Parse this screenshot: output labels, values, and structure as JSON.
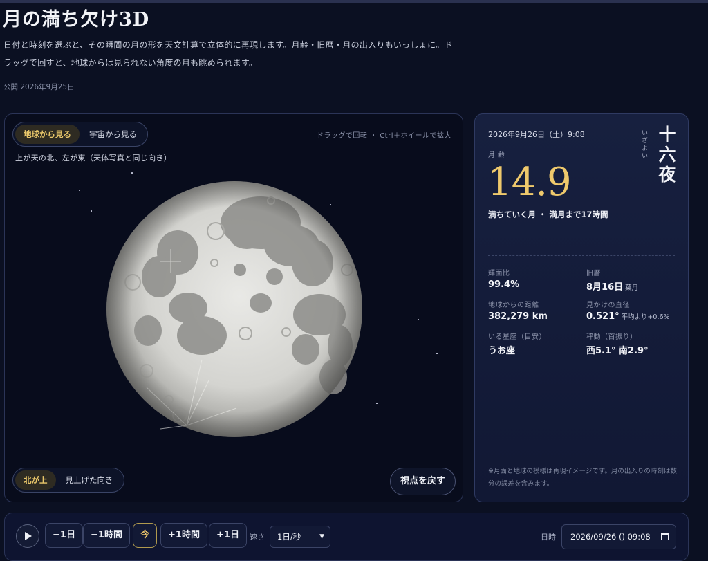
{
  "header": {
    "title": "月の満ち欠け3D",
    "description_line1": "日付と時刻を選ぶと、その瞬間の月の形を天文計算で立体的に再現します。月齢・旧暦・月の出入りもいっしょに。ド",
    "description_line2": "ラッグで回すと、地球からは見られない角度の月も眺められます。",
    "published": "公開 2026年9月25日"
  },
  "viewer": {
    "view_modes": [
      "地球から見る",
      "宇宙から見る"
    ],
    "active_view": "地球から見る",
    "hint": "ドラッグで回転 ・ Ctrl＋ホイールで拡大",
    "orientation_note": "上が天の北、左が東（天体写真と同じ向き）",
    "north_modes": [
      "北が上",
      "見上げた向き"
    ],
    "active_north": "北が上",
    "reset_label": "視点を戻す"
  },
  "info": {
    "datetime": "2026年9月26日（土）9:08",
    "age_label": "月齢",
    "age_value": "14.9",
    "status": "満ちていく月 ・ 満月まで17時間",
    "moon_name": "十六夜",
    "moon_name_reading": "いざよい",
    "stats": [
      {
        "label": "輝面比",
        "value": "99.4%",
        "sub": ""
      },
      {
        "label": "旧暦",
        "value": "8月16日",
        "sub": "葉月"
      },
      {
        "label": "地球からの距離",
        "value": "382,279 km",
        "sub": ""
      },
      {
        "label": "見かけの直径",
        "value": "0.521°",
        "sub": "平均より+0.6%"
      },
      {
        "label": "いる星座（目安）",
        "value": "うお座",
        "sub": ""
      },
      {
        "label": "秤動（首振り）",
        "value": "西5.1° 南2.9°",
        "sub": ""
      }
    ],
    "note": "※月面と地球の模様は再現イメージです。月の出入りの時刻は数分の誤差を含みます。"
  },
  "controls": {
    "buttons": [
      "−1日",
      "−1時間",
      "今",
      "+1時間",
      "+1日"
    ],
    "speed_label": "速さ",
    "speed_value": "1日/秒",
    "datetime_label": "日時",
    "datetime_value": "2026/09/26 () 09:08"
  },
  "colors": {
    "background": "#0b1022",
    "accent_gold": "#efc96c",
    "panel": "#17203f"
  }
}
